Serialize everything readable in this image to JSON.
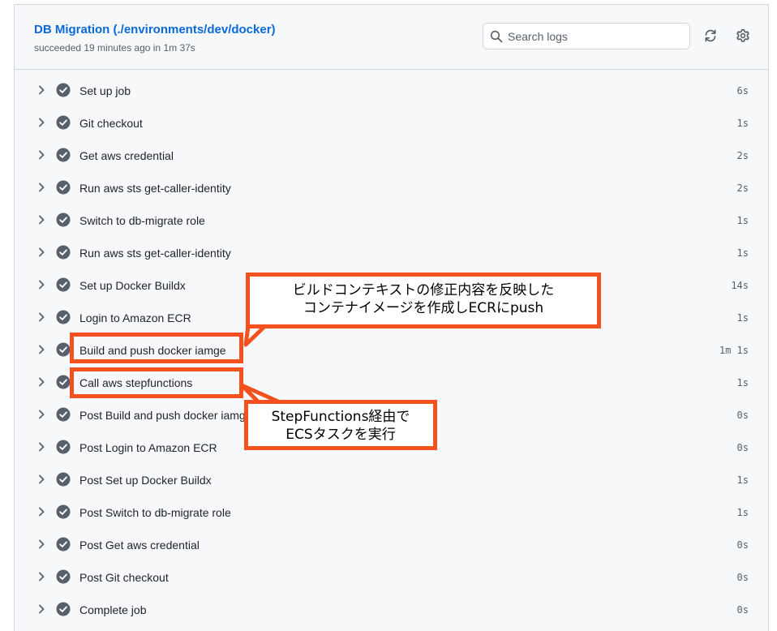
{
  "job": {
    "title": "DB Migration (./environments/dev/docker)",
    "status": "succeeded 19 minutes ago in 1m 37s"
  },
  "search": {
    "placeholder": "Search logs",
    "value": ""
  },
  "icons": {
    "search": "search-icon",
    "refresh": "refresh-icon",
    "settings": "gear-icon",
    "expand": "chevron-right-icon",
    "success": "check-circle-icon"
  },
  "colors": {
    "link": "#0969da",
    "success": "#57606a",
    "annotation": "#f4511e",
    "panel_bg": "#f6f8fa"
  },
  "steps": [
    {
      "name": "Set up job",
      "duration": "6s"
    },
    {
      "name": "Git checkout",
      "duration": "1s"
    },
    {
      "name": "Get aws credential",
      "duration": "2s"
    },
    {
      "name": "Run aws sts get-caller-identity",
      "duration": "2s"
    },
    {
      "name": "Switch to db-migrate role",
      "duration": "1s"
    },
    {
      "name": "Run aws sts get-caller-identity",
      "duration": "1s"
    },
    {
      "name": "Set up Docker Buildx",
      "duration": "14s"
    },
    {
      "name": "Login to Amazon ECR",
      "duration": "1s"
    },
    {
      "name": "Build and push docker iamge",
      "duration": "1m 1s"
    },
    {
      "name": "Call aws stepfunctions",
      "duration": "1s"
    },
    {
      "name": "Post Build and push docker iamge",
      "duration": "0s"
    },
    {
      "name": "Post Login to Amazon ECR",
      "duration": "0s"
    },
    {
      "name": "Post Set up Docker Buildx",
      "duration": "1s"
    },
    {
      "name": "Post Switch to db-migrate role",
      "duration": "1s"
    },
    {
      "name": "Post Get aws credential",
      "duration": "0s"
    },
    {
      "name": "Post Git checkout",
      "duration": "0s"
    },
    {
      "name": "Complete job",
      "duration": "0s"
    }
  ],
  "annotations": {
    "callout_build": {
      "line1": "ビルドコンテキストの修正内容を反映した",
      "line2": "コンテナイメージを作成しECRにpush"
    },
    "callout_stepfunctions": {
      "line1": "StepFunctions経由で",
      "line2": "ECSタスクを実行"
    }
  }
}
